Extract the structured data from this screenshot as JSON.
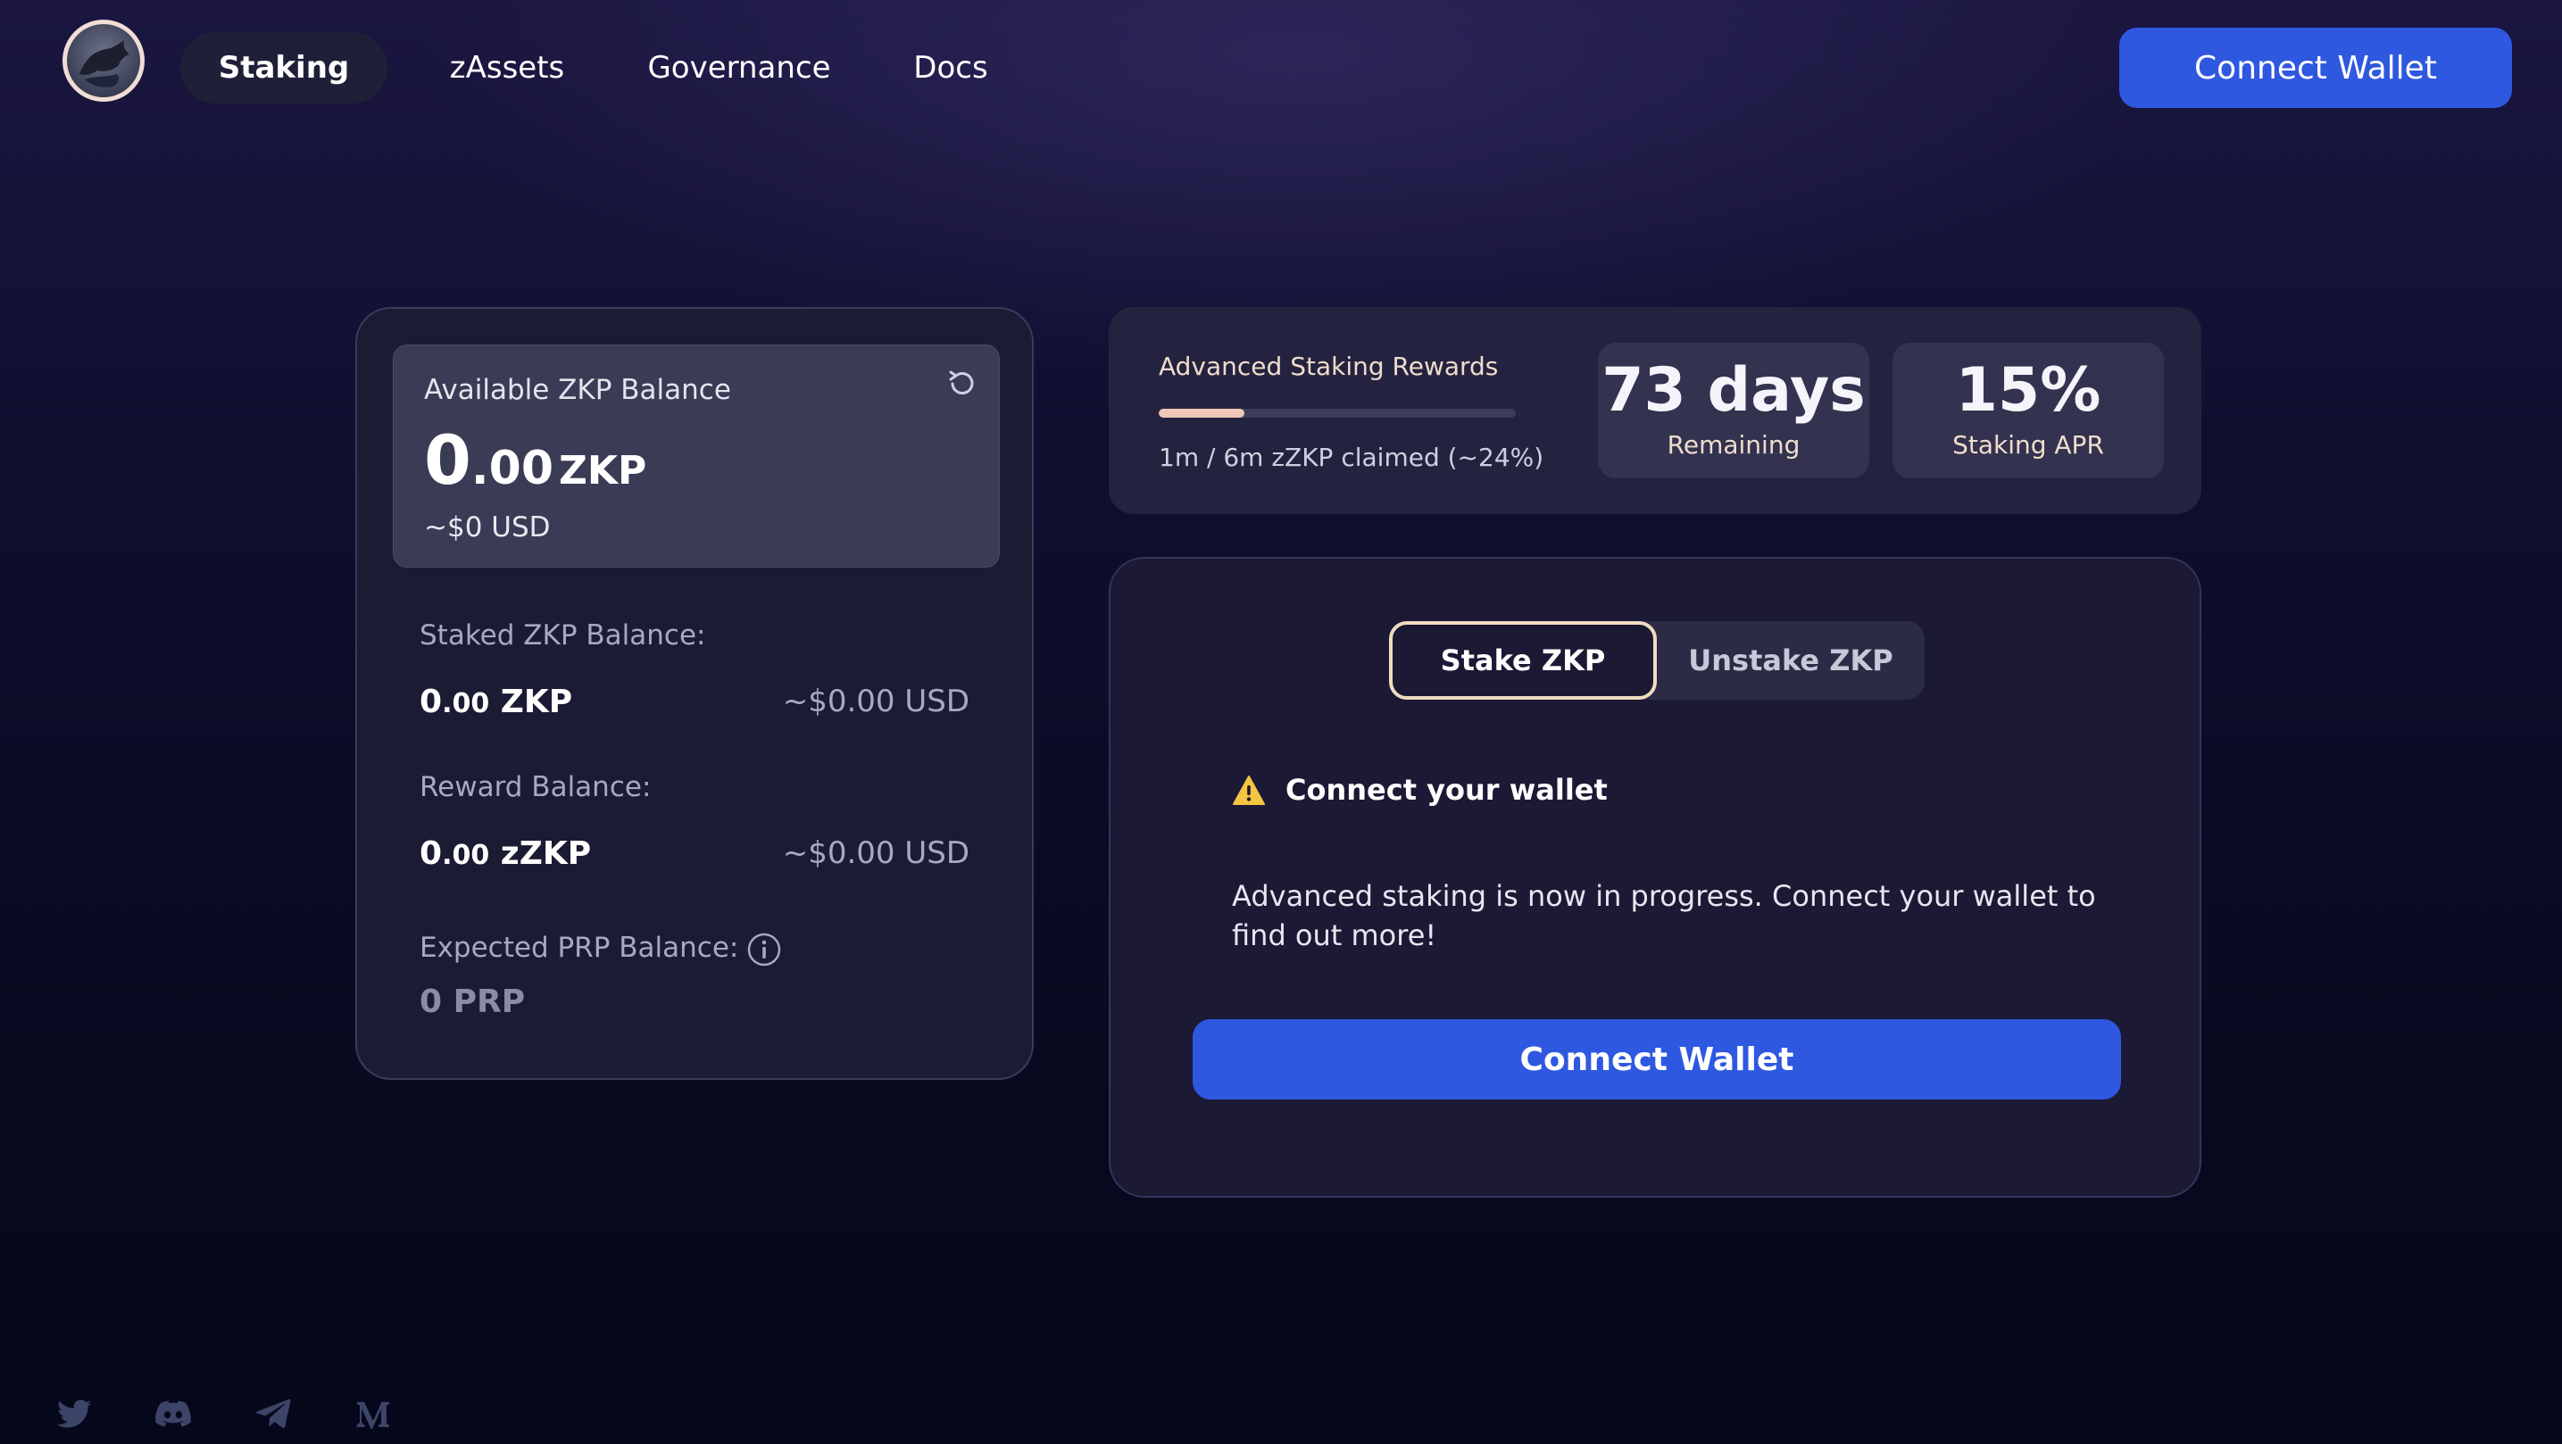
{
  "nav": {
    "tabs": [
      {
        "label": "Staking",
        "active": true
      },
      {
        "label": "zAssets",
        "active": false
      },
      {
        "label": "Governance",
        "active": false
      },
      {
        "label": "Docs",
        "active": false
      }
    ],
    "connect_label": "Connect Wallet"
  },
  "balance": {
    "available_label": "Available ZKP Balance",
    "available_int": "0",
    "available_dec": ".00",
    "available_unit": "ZKP",
    "available_usd": "~$0 USD",
    "staked_label": "Staked ZKP Balance:",
    "staked_int": "0",
    "staked_dec": ".00",
    "staked_unit": "ZKP",
    "staked_usd": "~$0.00 USD",
    "reward_label": "Reward Balance:",
    "reward_int": "0",
    "reward_dec": ".00",
    "reward_unit": "zZKP",
    "reward_usd": "~$0.00 USD",
    "prp_label": "Expected PRP Balance:",
    "prp_value": "0 PRP"
  },
  "rewards": {
    "title": "Advanced Staking Rewards",
    "progress": 0.24,
    "claimed_text": "1m / 6m zZKP claimed (~24%)",
    "days_value": "73 days",
    "days_label": "Remaining",
    "apr_value": "15%",
    "apr_label": "Staking APR"
  },
  "action": {
    "tab_stake": "Stake ZKP",
    "tab_unstake": "Unstake ZKP",
    "warning_title": "Connect your wallet",
    "warning_text": "Advanced staking is now in progress. Connect your wallet to find out more!",
    "connect_label": "Connect Wallet"
  },
  "colors": {
    "accent_blue": "#2f58e0",
    "highlight_cream": "#f1dcc0",
    "warning_yellow": "#f5c542"
  },
  "social_icons": [
    "twitter-icon",
    "discord-icon",
    "telegram-icon",
    "medium-icon"
  ]
}
